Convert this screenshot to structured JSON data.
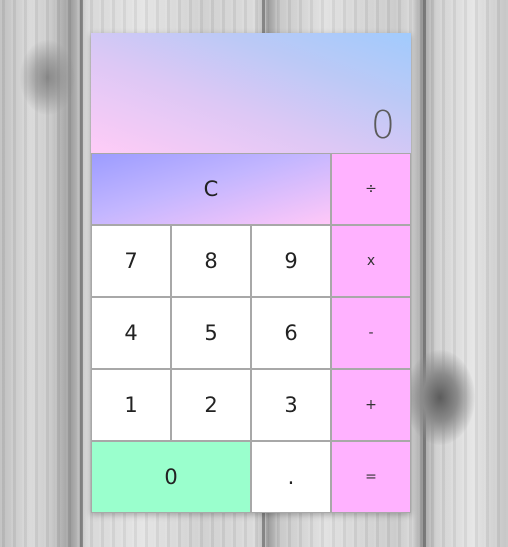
{
  "display": {
    "value": "0"
  },
  "keys": {
    "clear": "C",
    "divide": "÷",
    "seven": "7",
    "eight": "8",
    "nine": "9",
    "multiply": "x",
    "four": "4",
    "five": "5",
    "six": "6",
    "subtract": "-",
    "one": "1",
    "two": "2",
    "three": "3",
    "add": "+",
    "zero": "0",
    "decimal": ".",
    "equals": "="
  },
  "colors": {
    "operator_key": "#ffb2ff",
    "zero_key": "#9affcd",
    "number_key": "#ffffff",
    "display_gradient": [
      "#ffccf7",
      "#a1cbfd"
    ],
    "clear_gradient": [
      "#ffc8f8",
      "#9c9cff"
    ]
  }
}
